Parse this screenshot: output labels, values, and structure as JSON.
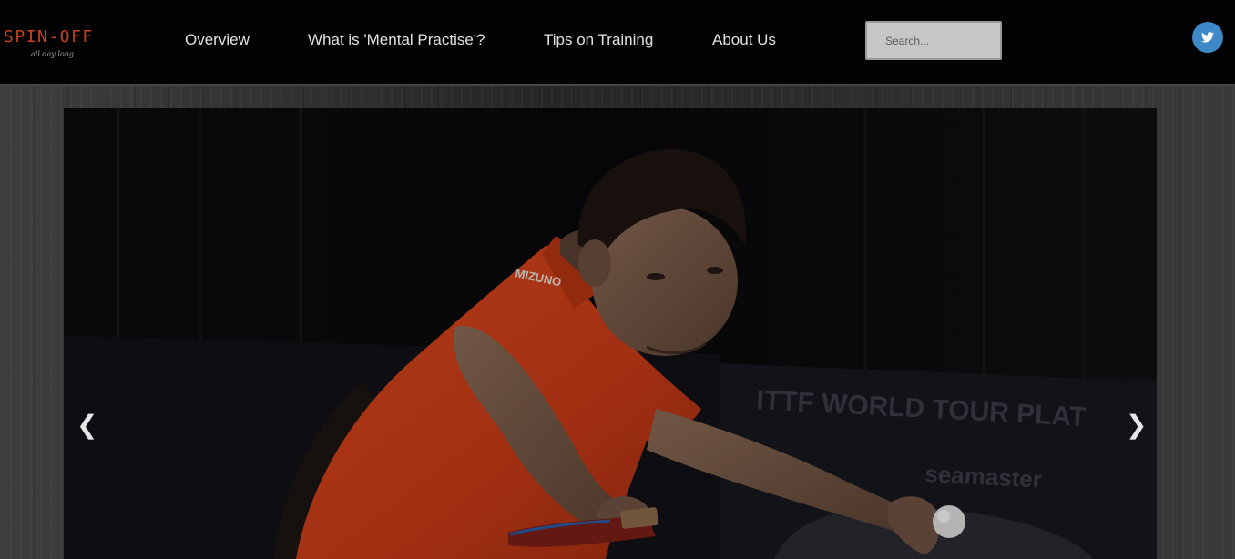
{
  "brand": {
    "name": "SPIN-OFF",
    "tagline": "all day long",
    "color": "#c8401c"
  },
  "nav": [
    {
      "label": "Overview"
    },
    {
      "label": "What is 'Mental Practise'?"
    },
    {
      "label": "Tips on Training"
    },
    {
      "label": "About Us"
    }
  ],
  "search": {
    "placeholder": "Search..."
  },
  "social": {
    "icon": "twitter-icon",
    "color": "#3d88c7"
  },
  "carousel": {
    "prev_label": "❮",
    "next_label": "❯",
    "image": {
      "description": "table tennis player in orange shirt hitting forehand",
      "background_text_1": "ITTF WORLD TOUR PLAT",
      "background_text_2": "seamaster",
      "shirt_text": "MIZUNO"
    }
  }
}
